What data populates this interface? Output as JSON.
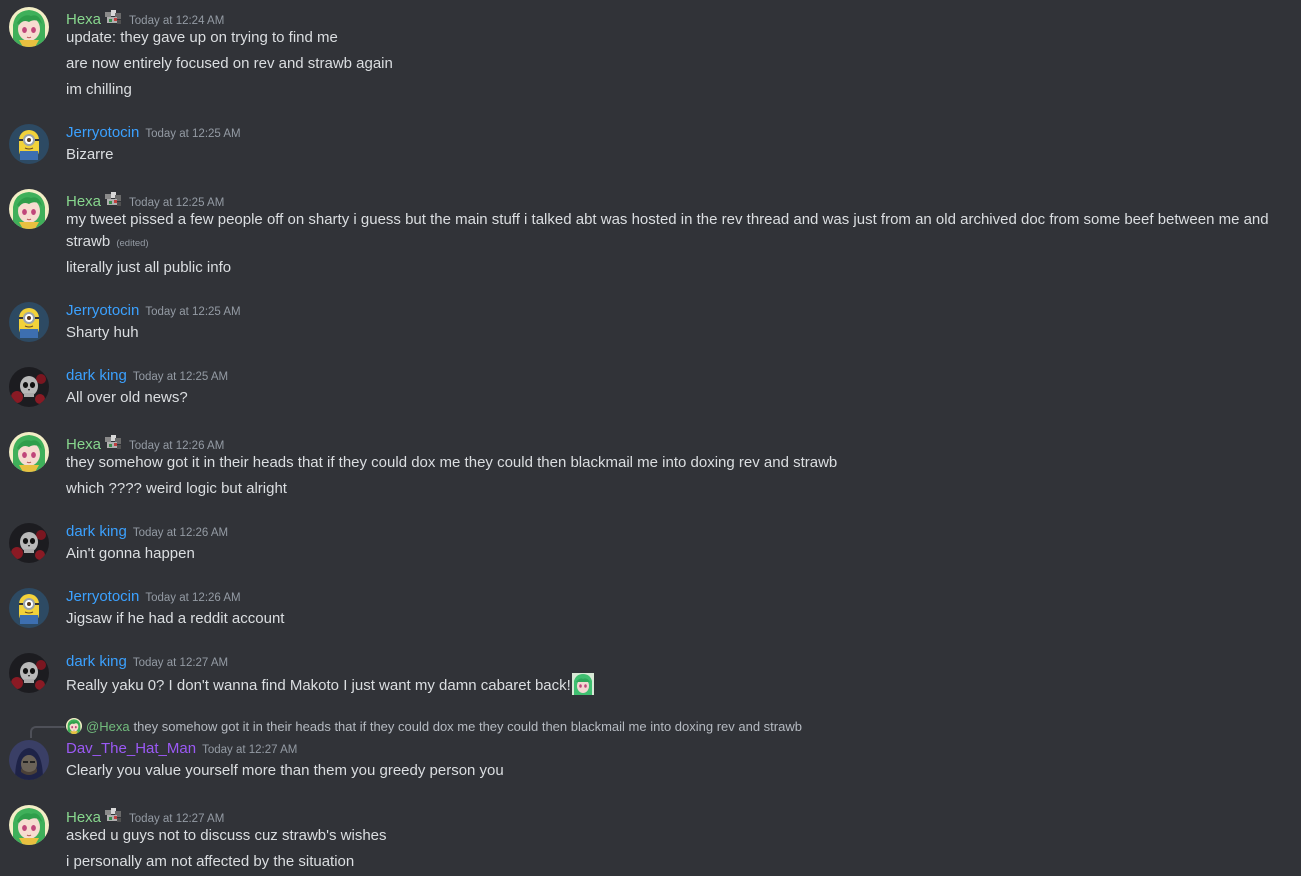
{
  "users": {
    "hexa": {
      "name": "Hexa",
      "color": "#87d68d"
    },
    "jerry": {
      "name": "Jerryotocin",
      "color": "#3ba1ff"
    },
    "dark": {
      "name": "dark king",
      "color": "#3ba1ff"
    },
    "dav": {
      "name": "Dav_The_Hat_Man",
      "color": "#9b59f5"
    }
  },
  "messages": [
    {
      "author": "Hexa",
      "timestamp": "Today at 12:24 AM",
      "lines": [
        "update: they gave up on trying to find me",
        "are now entirely focused on rev and strawb again",
        "im chilling"
      ]
    },
    {
      "author": "Jerryotocin",
      "timestamp": "Today at 12:25 AM",
      "lines": [
        "Bizarre"
      ]
    },
    {
      "author": "Hexa",
      "timestamp": "Today at 12:25 AM",
      "lines": [
        "my tweet pissed a few people off on sharty i guess but the main stuff i talked abt was hosted in the rev thread and was just from an old archived doc from some beef between me and strawb",
        "literally just all public info"
      ],
      "edited": "(edited)"
    },
    {
      "author": "Jerryotocin",
      "timestamp": "Today at 12:25 AM",
      "lines": [
        "Sharty huh"
      ]
    },
    {
      "author": "dark king",
      "timestamp": "Today at 12:25 AM",
      "lines": [
        "All over old news?"
      ]
    },
    {
      "author": "Hexa",
      "timestamp": "Today at 12:26 AM",
      "lines": [
        "they somehow got it in their heads that if they could dox me they could then blackmail me into doxing rev and strawb",
        "which ???? weird logic but alright"
      ]
    },
    {
      "author": "dark king",
      "timestamp": "Today at 12:26 AM",
      "lines": [
        "Ain't gonna happen"
      ]
    },
    {
      "author": "Jerryotocin",
      "timestamp": "Today at 12:26 AM",
      "lines": [
        "Jigsaw if he had a reddit account"
      ]
    },
    {
      "author": "dark king",
      "timestamp": "Today at 12:27 AM",
      "lines": [
        "Really yaku 0? I don't wanna find Makoto I just want my damn cabaret back!"
      ]
    },
    {
      "author": "Dav_The_Hat_Man",
      "timestamp": "Today at 12:27 AM",
      "lines": [
        "Clearly you value yourself more than them you greedy person you"
      ],
      "reply": {
        "user": "@Hexa",
        "text": "they somehow got it in their heads that if they could dox me they could then blackmail me into doxing rev and strawb"
      }
    },
    {
      "author": "Hexa",
      "timestamp": "Today at 12:27 AM",
      "lines": [
        "asked u guys not to discuss cuz strawb's wishes",
        "i personally am not affected by the situation"
      ]
    }
  ],
  "icons": {
    "hexa_avatar": "anime-avatar-green-hair",
    "jerry_avatar": "minion-avatar",
    "dark_avatar": "skull-avatar",
    "dav_avatar": "hooded-figure-avatar",
    "hexa_badge": "pixel-badge-icon",
    "inline_emoji": "anime-emoji-icon"
  }
}
